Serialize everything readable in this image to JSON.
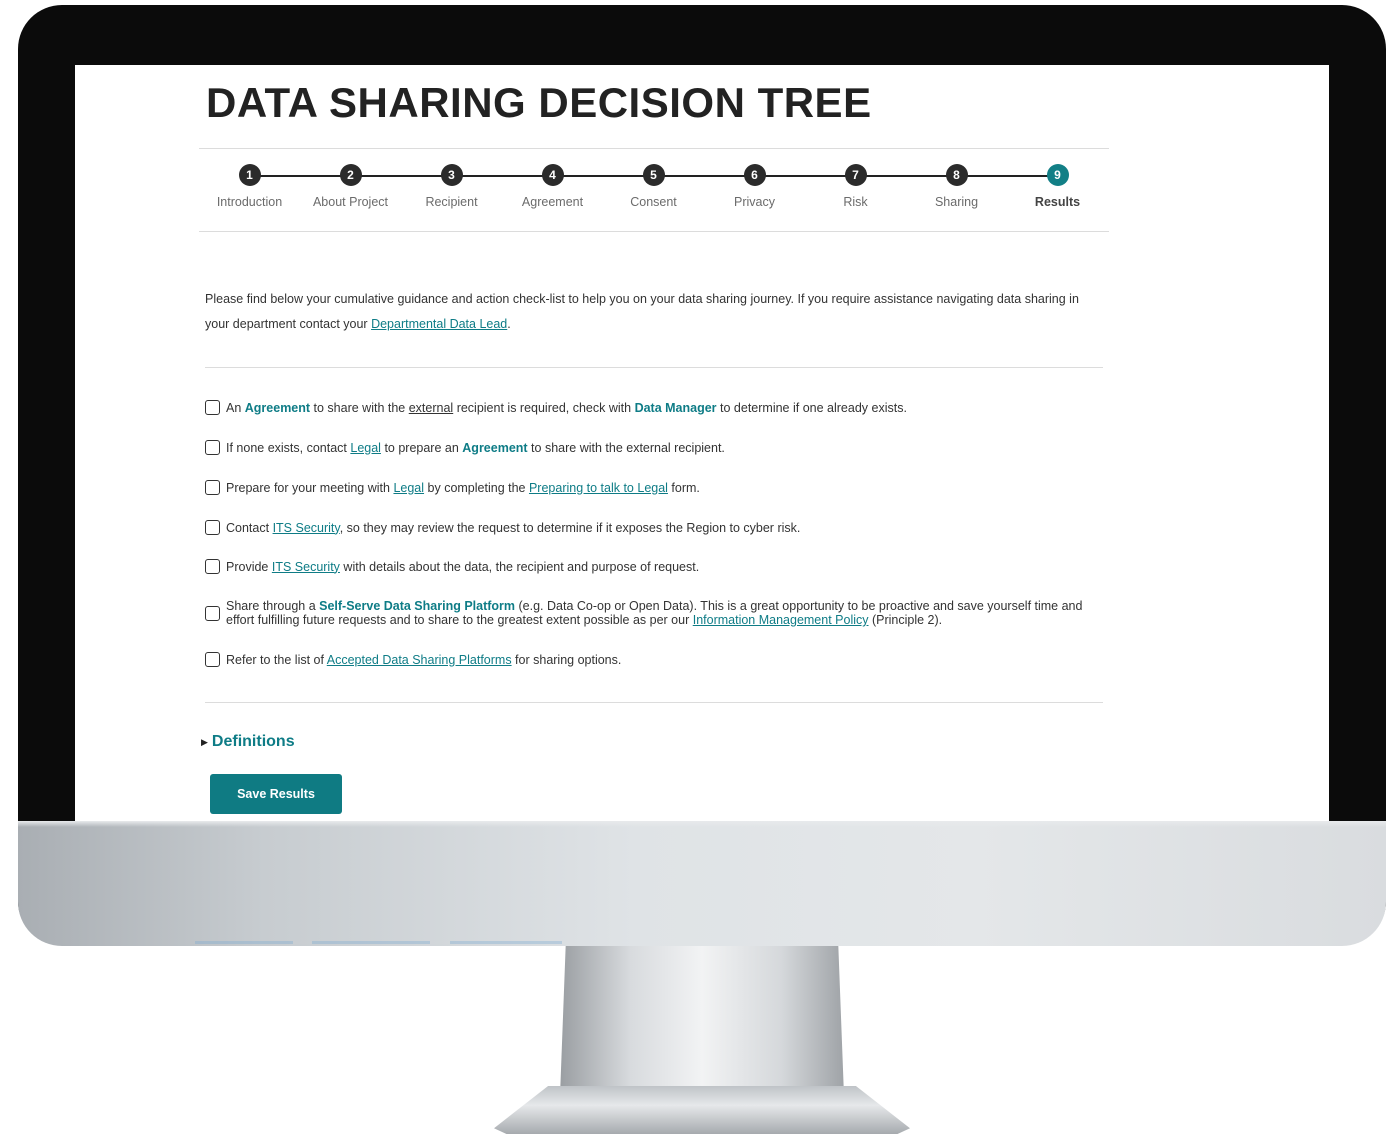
{
  "page": {
    "title": "DATA SHARING DECISION TREE"
  },
  "stepper": {
    "steps": [
      {
        "number": "1",
        "label": "Introduction"
      },
      {
        "number": "2",
        "label": "About Project"
      },
      {
        "number": "3",
        "label": "Recipient"
      },
      {
        "number": "4",
        "label": "Agreement"
      },
      {
        "number": "5",
        "label": "Consent"
      },
      {
        "number": "6",
        "label": "Privacy"
      },
      {
        "number": "7",
        "label": "Risk"
      },
      {
        "number": "8",
        "label": "Sharing"
      },
      {
        "number": "9",
        "label": "Results"
      }
    ],
    "active_step": "9"
  },
  "intro": {
    "text_before_link": "Please find below your cumulative guidance and action check-list to help you on your data sharing journey. If you require assistance navigating data sharing in your department contact your ",
    "link_text": "Departmental Data Lead",
    "text_after_link": "."
  },
  "checklist": {
    "item1": {
      "t1": "An ",
      "b1": "Agreement",
      "t2": " to share with the ",
      "u1": "external",
      "t3": " recipient is required, check with ",
      "b2": "Data Manager",
      "t4": " to determine if one already exists.",
      "checked": false
    },
    "item2": {
      "t1": "If none exists, contact ",
      "l1": "Legal",
      "t2": " to prepare an ",
      "b1": "Agreement",
      "t3": " to share with the external recipient.",
      "checked": false
    },
    "item3": {
      "t1": "Prepare for your meeting with ",
      "l1": "Legal",
      "t2": " by completing the ",
      "l2": "Preparing to talk to Legal",
      "t3": " form.",
      "checked": false
    },
    "item4": {
      "t1": "Contact ",
      "l1": "ITS Security",
      "t2": ", so they may review the request to determine if it exposes the Region to cyber risk.",
      "checked": false
    },
    "item5": {
      "t1": "Provide ",
      "l1": "ITS Security",
      "t2": " with details about the data, the recipient and purpose of request.",
      "checked": false
    },
    "item6": {
      "t1": "Share through a ",
      "b1": "Self-Serve Data Sharing Platform",
      "t2": " (e.g. Data Co-op or Open Data). This is a great opportunity to be proactive and save yourself time and effort fulfilling future requests and to share to the greatest extent possible as per our ",
      "l1": "Information Management Policy",
      "t3": " (Principle 2).",
      "checked": false
    },
    "item7": {
      "t1": "Refer to the list of ",
      "l1": "Accepted Data Sharing Platforms",
      "t2": " for sharing options.",
      "checked": false
    }
  },
  "definitions": {
    "toggle_icon": "triangle-right",
    "label": "Definitions"
  },
  "actions": {
    "save_label": "Save Results"
  },
  "colors": {
    "accent": "#0e7c86",
    "button": "#0f7b83",
    "step_inactive": "#2b2b2b",
    "title": "#222222"
  }
}
